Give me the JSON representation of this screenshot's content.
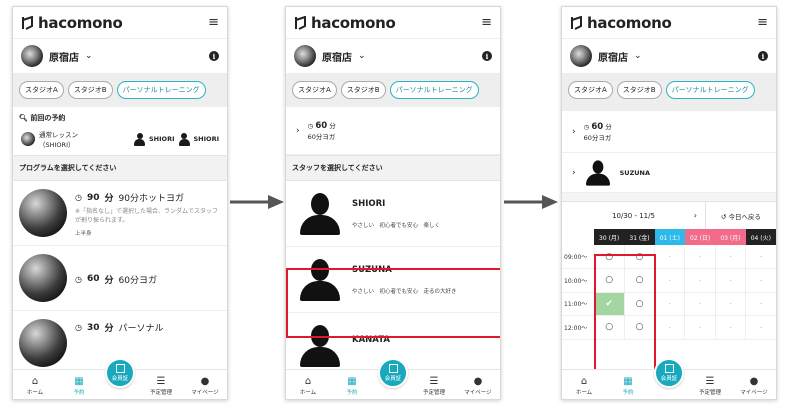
{
  "brand": "hacomono",
  "store": "原宿店",
  "studios": [
    "スタジオA",
    "スタジオB",
    "パーソナルトレーニング"
  ],
  "tabs": {
    "home": "ホーム",
    "reserve": "予約",
    "member": "会員証",
    "schedule": "予定管理",
    "mypage": "マイページ"
  },
  "screen1": {
    "prev_title": "前回の予約",
    "prev_lesson_name": "通常レッスン",
    "prev_lesson_staff": "（SHIORI）",
    "prev_staff_a": "SHIORI",
    "prev_staff_b": "SHIORI",
    "program_title": "プログラムを選択してください",
    "programs": [
      {
        "minutes": "90",
        "unit": "分",
        "name": "90分ホットヨガ",
        "note": "※「指名なし」で選択した場合、ランダムでスタッフが割り振られます。",
        "tag": "上半身"
      },
      {
        "minutes": "60",
        "unit": "分",
        "name": "60分ヨガ"
      },
      {
        "minutes": "30",
        "unit": "分",
        "name": "パーソナル"
      }
    ]
  },
  "screen2": {
    "selected_minutes": "60",
    "selected_unit": "分",
    "selected_name": "60分ヨガ",
    "staff_title": "スタッフを選択してください",
    "staff": [
      {
        "name": "SHIORI",
        "tags": "やさしい　初心者でも安心　楽しく"
      },
      {
        "name": "SUZUNA",
        "tags": "やさしい　初心者でも安心　走るの大好き"
      },
      {
        "name": "KANATA"
      }
    ]
  },
  "screen3": {
    "selected_minutes": "60",
    "selected_unit": "分",
    "selected_name": "60分ヨガ",
    "selected_staff": "SUZUNA",
    "week_range": "10/30 - 11/5",
    "back_label": "今日へ戻る",
    "days": [
      {
        "label": "30 (月)",
        "color": "#222222"
      },
      {
        "label": "31 (金)",
        "color": "#222222"
      },
      {
        "label": "01 (土)",
        "color": "#2fb9e8"
      },
      {
        "label": "02 (日)",
        "color": "#f26b8a"
      },
      {
        "label": "03 (月)",
        "color": "#f26b8a"
      },
      {
        "label": "04 (火)",
        "color": "#222222"
      }
    ],
    "times": [
      "09:00～",
      "10:00～",
      "11:00～",
      "12:00～"
    ],
    "slots": [
      [
        "○",
        "○",
        "-",
        "-",
        "-",
        "-"
      ],
      [
        "○",
        "○",
        "-",
        "-",
        "-",
        "-"
      ],
      [
        "✔",
        "○",
        "-",
        "-",
        "-",
        "-"
      ],
      [
        "○",
        "○",
        "-",
        "-",
        "-",
        "-"
      ]
    ]
  }
}
